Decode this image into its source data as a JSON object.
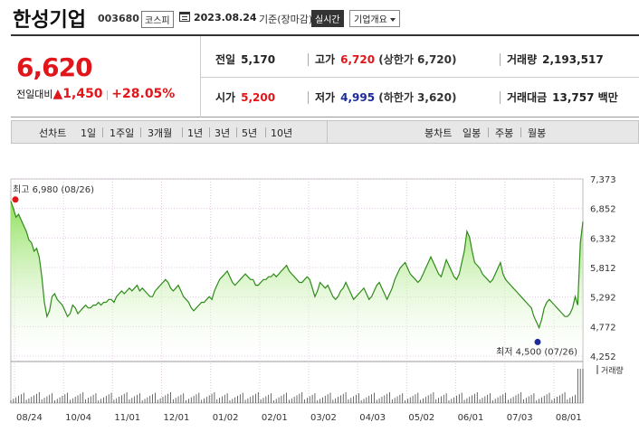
{
  "header": {
    "company_name": "한성기업",
    "code": "003680",
    "market": "코스피",
    "date": "2023.08.24",
    "date_suffix": "기준(장마감)",
    "realtime_label": "실시간",
    "company_overview_label": "기업개요"
  },
  "summary": {
    "current_price": "6,620",
    "change_label": "전일대비",
    "change_arrow": "▲",
    "change_value": "1,450",
    "change_percent": "+28.05%",
    "prev_close_label": "전일",
    "prev_close": "5,170",
    "high_label": "고가",
    "high": "6,720",
    "upper_limit": "(상한가 6,720)",
    "volume_label": "거래량",
    "volume": "2,193,517",
    "open_label": "시가",
    "open": "5,200",
    "low_label": "저가",
    "low": "4,995",
    "lower_limit": "(하한가 3,620)",
    "amount_label": "거래대금",
    "amount": "13,757",
    "amount_unit": "백만"
  },
  "tabs": {
    "line_chart": "선차트",
    "d1": "1일",
    "w1": "1주일",
    "m3": "3개월",
    "y1": "1년",
    "y3": "3년",
    "y5": "5년",
    "y10": "10년",
    "candle_chart": "봉차트",
    "daily": "일봉",
    "weekly": "주봉",
    "monthly": "월봉"
  },
  "colors": {
    "up": "#e0161a",
    "down": "#1d2b9a",
    "line": "#2e8b1a",
    "fill_top": "#8ee05a",
    "grid": "#e2c8e2"
  },
  "chart_data": {
    "type": "area",
    "y_ticks": [
      "7,373",
      "6,852",
      "6,332",
      "5,812",
      "5,292",
      "4,772",
      "4,252"
    ],
    "ylim": [
      4252,
      7373
    ],
    "x_ticks": [
      "08/24",
      "10/04",
      "11/01",
      "12/01",
      "01/02",
      "02/01",
      "03/02",
      "04/03",
      "05/02",
      "06/01",
      "07/03",
      "08/01"
    ],
    "high_annotation": "최고 6,980 (08/26)",
    "low_annotation": "최저 4,500 (07/26)",
    "volume_label": "거래량",
    "values": [
      6980,
      6850,
      6700,
      6750,
      6650,
      6550,
      6450,
      6300,
      6250,
      6100,
      6150,
      6000,
      5650,
      5200,
      4950,
      5050,
      5300,
      5350,
      5250,
      5200,
      5150,
      5050,
      4950,
      5000,
      5150,
      5100,
      5000,
      5050,
      5100,
      5150,
      5100,
      5100,
      5150,
      5150,
      5200,
      5150,
      5200,
      5200,
      5250,
      5250,
      5200,
      5300,
      5350,
      5400,
      5350,
      5400,
      5450,
      5400,
      5450,
      5500,
      5400,
      5450,
      5400,
      5350,
      5300,
      5300,
      5400,
      5450,
      5500,
      5550,
      5600,
      5550,
      5450,
      5400,
      5450,
      5500,
      5400,
      5300,
      5250,
      5200,
      5100,
      5050,
      5100,
      5150,
      5200,
      5200,
      5250,
      5300,
      5250,
      5400,
      5500,
      5600,
      5650,
      5700,
      5750,
      5650,
      5550,
      5500,
      5550,
      5600,
      5650,
      5700,
      5650,
      5600,
      5600,
      5500,
      5500,
      5550,
      5600,
      5600,
      5650,
      5650,
      5700,
      5650,
      5700,
      5750,
      5800,
      5850,
      5750,
      5700,
      5650,
      5600,
      5550,
      5550,
      5600,
      5650,
      5600,
      5450,
      5300,
      5400,
      5550,
      5500,
      5450,
      5500,
      5400,
      5300,
      5250,
      5300,
      5400,
      5450,
      5550,
      5450,
      5350,
      5250,
      5300,
      5350,
      5400,
      5450,
      5350,
      5250,
      5300,
      5400,
      5500,
      5550,
      5450,
      5350,
      5250,
      5350,
      5450,
      5600,
      5700,
      5800,
      5850,
      5900,
      5800,
      5700,
      5650,
      5600,
      5550,
      5600,
      5700,
      5800,
      5900,
      6000,
      5900,
      5800,
      5700,
      5650,
      5800,
      5950,
      5850,
      5750,
      5650,
      5600,
      5700,
      5900,
      6100,
      6450,
      6350,
      6100,
      5900,
      5850,
      5800,
      5700,
      5650,
      5600,
      5550,
      5600,
      5700,
      5800,
      5900,
      5700,
      5600,
      5550,
      5500,
      5450,
      5400,
      5350,
      5300,
      5250,
      5200,
      5150,
      5100,
      4950,
      4850,
      4750,
      4900,
      5100,
      5200,
      5250,
      5200,
      5150,
      5100,
      5050,
      5000,
      4950,
      4950,
      5000,
      5100,
      5300,
      5150,
      6250,
      6620
    ]
  }
}
